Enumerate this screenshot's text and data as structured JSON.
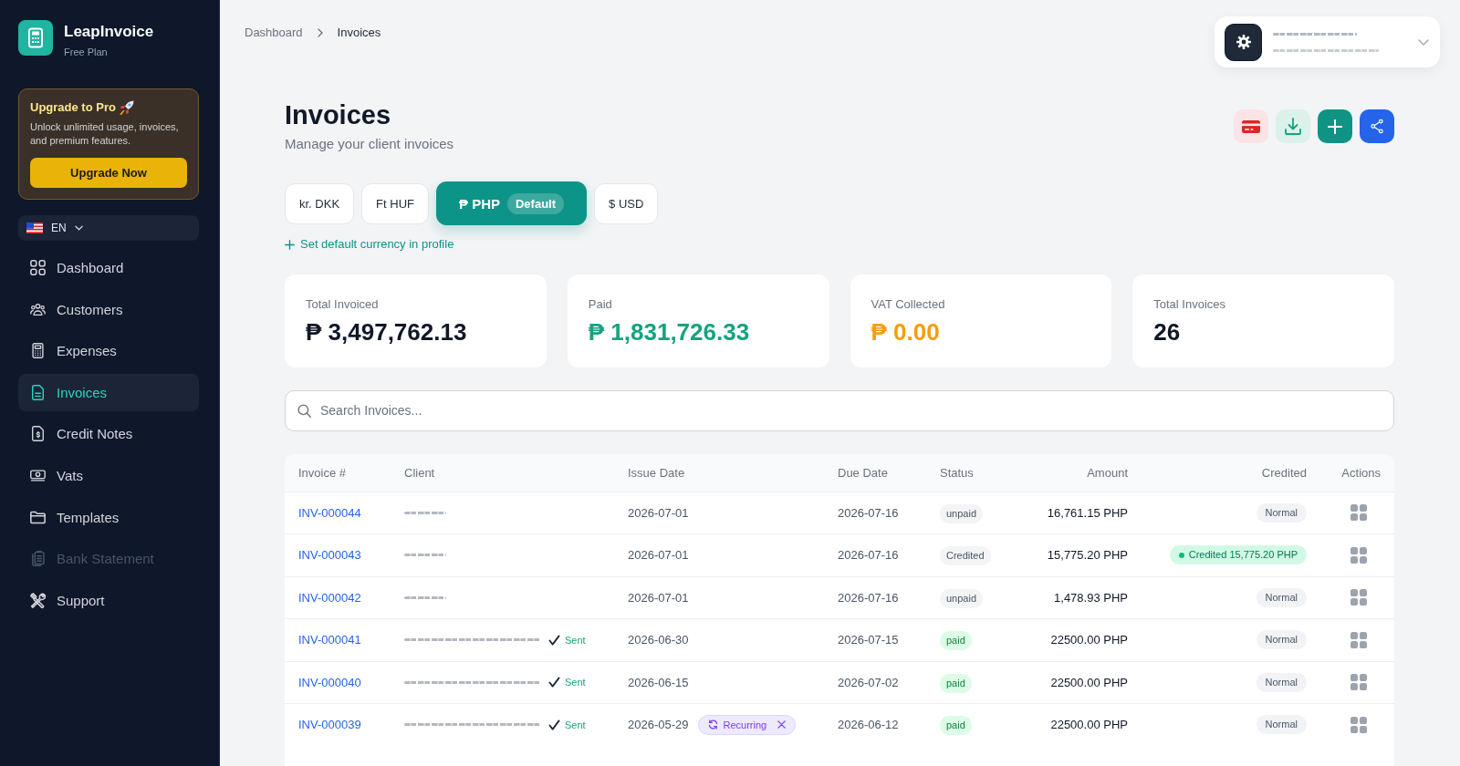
{
  "sidebar": {
    "app_name": "LeapInvoice",
    "plan": "Free Plan",
    "upgrade": {
      "title": "Upgrade to Pro",
      "description": "Unlock unlimited usage, invoices, and premium features.",
      "button": "Upgrade Now"
    },
    "language": "EN",
    "items": [
      {
        "label": "Dashboard",
        "selected": false,
        "disabled": false
      },
      {
        "label": "Customers",
        "selected": false,
        "disabled": false
      },
      {
        "label": "Expenses",
        "selected": false,
        "disabled": false
      },
      {
        "label": "Invoices",
        "selected": true,
        "disabled": false
      },
      {
        "label": "Credit Notes",
        "selected": false,
        "disabled": false
      },
      {
        "label": "Vats",
        "selected": false,
        "disabled": false
      },
      {
        "label": "Templates",
        "selected": false,
        "disabled": false
      },
      {
        "label": "Bank Statement",
        "selected": false,
        "disabled": true
      },
      {
        "label": "Support",
        "selected": false,
        "disabled": false
      }
    ]
  },
  "breadcrumb": [
    "Dashboard",
    "Invoices"
  ],
  "account": {
    "obscured": true
  },
  "page": {
    "title": "Invoices",
    "subtitle": "Manage your client invoices"
  },
  "currency_tabs": [
    {
      "label": "kr. DKK",
      "selected": false
    },
    {
      "label": "Ft HUF",
      "selected": false
    },
    {
      "label": "₱ PHP",
      "selected": true,
      "badge": "Default"
    },
    {
      "label": "$ USD",
      "selected": false
    }
  ],
  "currency_link": "Set default currency in profile",
  "stats": [
    {
      "label": "Total Invoiced",
      "value": "₱ 3,497,762.13",
      "color": "#111827"
    },
    {
      "label": "Paid",
      "value": "₱ 1,831,726.33",
      "color": "#16a37f"
    },
    {
      "label": "VAT Collected",
      "value": "₱ 0.00",
      "color": "#f59e0b"
    },
    {
      "label": "Total Invoices",
      "value": "26",
      "color": "#111827"
    }
  ],
  "search": {
    "placeholder": "Search Invoices..."
  },
  "table": {
    "columns": [
      "Invoice #",
      "Client",
      "Issue Date",
      "Due Date",
      "Status",
      "Amount",
      "Credited",
      "Actions"
    ],
    "rows": [
      {
        "invoice": "INV-000044",
        "client_obscured": true,
        "issue_date": "2026-07-01",
        "due_date": "2026-07-16",
        "status": {
          "text": "unpaid",
          "kind": "neutral"
        },
        "amount": "16,761.15 PHP",
        "credited": {
          "text": "Normal",
          "kind": "normal"
        }
      },
      {
        "invoice": "INV-000043",
        "client_obscured": true,
        "issue_date": "2026-07-01",
        "due_date": "2026-07-16",
        "status": {
          "text": "Credited",
          "kind": "neutral"
        },
        "amount": "15,775.20 PHP",
        "credited": {
          "text": "Credited 15,775.20 PHP",
          "kind": "credited"
        }
      },
      {
        "invoice": "INV-000042",
        "client_obscured": true,
        "issue_date": "2026-07-01",
        "due_date": "2026-07-16",
        "status": {
          "text": "unpaid",
          "kind": "neutral"
        },
        "amount": "1,478.93 PHP",
        "credited": {
          "text": "Normal",
          "kind": "normal"
        }
      },
      {
        "invoice": "INV-000041",
        "client_obscured": true,
        "sent": "Sent",
        "issue_date": "2026-06-30",
        "due_date": "2026-07-15",
        "status": {
          "text": "paid",
          "kind": "success"
        },
        "amount": "22500.00 PHP",
        "credited": {
          "text": "Normal",
          "kind": "normal"
        }
      },
      {
        "invoice": "INV-000040",
        "client_obscured": true,
        "sent": "Sent",
        "issue_date": "2026-06-15",
        "due_date": "2026-07-02",
        "status": {
          "text": "paid",
          "kind": "success"
        },
        "amount": "22500.00 PHP",
        "credited": {
          "text": "Normal",
          "kind": "normal"
        }
      },
      {
        "invoice": "INV-000039",
        "client_obscured": true,
        "sent": "Sent",
        "issue_date": "2026-05-29",
        "recurring": "Recurring",
        "due_date": "2026-06-12",
        "status": {
          "text": "paid",
          "kind": "success"
        },
        "amount": "22500.00 PHP",
        "credited": {
          "text": "Normal",
          "kind": "normal"
        }
      }
    ]
  }
}
